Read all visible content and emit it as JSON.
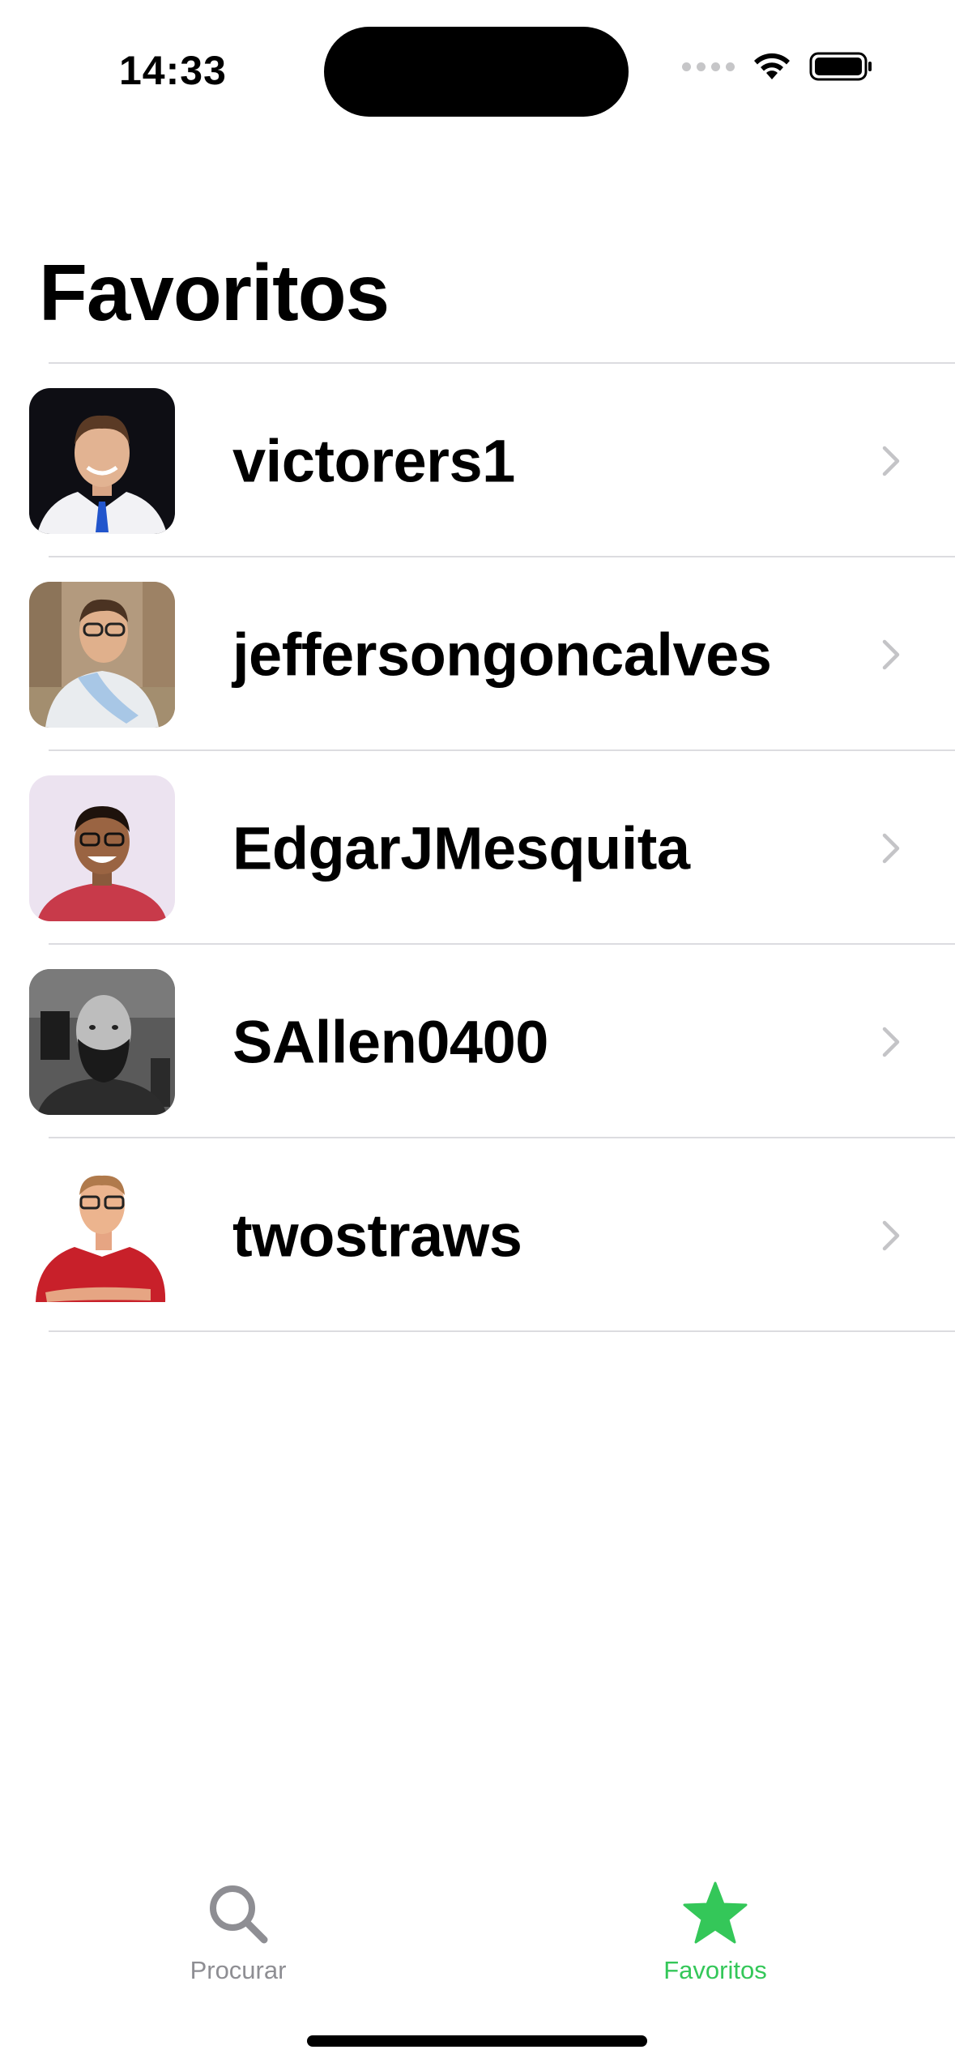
{
  "status_bar": {
    "time": "14:33"
  },
  "header": {
    "title": "Favoritos"
  },
  "favorites": [
    {
      "username": "victorers1",
      "avatar": "avatar-photo-man-suit"
    },
    {
      "username": "jeffersongoncalves",
      "avatar": "avatar-photo-man-outdoor"
    },
    {
      "username": "EdgarJMesquita",
      "avatar": "avatar-photo-man-smiling"
    },
    {
      "username": "SAllen0400",
      "avatar": "avatar-photo-man-bearded"
    },
    {
      "username": "twostraws",
      "avatar": "avatar-photo-man-red-shirt"
    }
  ],
  "tab_bar": {
    "tabs": [
      {
        "label": "Procurar",
        "icon": "magnifying-glass-icon",
        "selected": false
      },
      {
        "label": "Favoritos",
        "icon": "star-fill-icon",
        "selected": true
      }
    ]
  },
  "colors": {
    "accent": "#34c759",
    "inactive": "#8e8e93",
    "separator": "#dcdce0",
    "chevron": "#c4c4c7"
  }
}
